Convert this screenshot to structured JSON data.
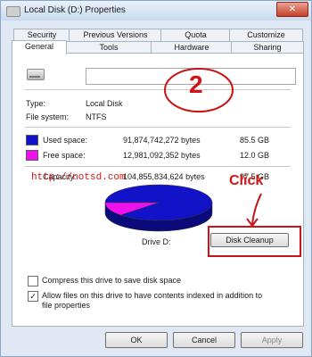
{
  "window": {
    "title": "Local Disk (D:) Properties",
    "close_glyph": "✕"
  },
  "tabs_back": [
    "Security",
    "Previous Versions",
    "Quota",
    "Customize"
  ],
  "tabs_front": [
    "General",
    "Tools",
    "Hardware",
    "Sharing"
  ],
  "general": {
    "name_value": "",
    "type_label": "Type:",
    "type_value": "Local Disk",
    "fs_label": "File system:",
    "fs_value": "NTFS",
    "used": {
      "label": "Used space:",
      "bytes": "91,874,742,272 bytes",
      "size": "85.5 GB",
      "color": "#1212c8"
    },
    "free": {
      "label": "Free space:",
      "bytes": "12,981,092,352 bytes",
      "size": "12.0 GB",
      "color": "#ee10ee"
    },
    "capacity": {
      "label": "Capacity:",
      "bytes": "104,855,834,624 bytes",
      "size": "97.5 GB"
    },
    "drive_label": "Drive D:",
    "cleanup_label": "Disk Cleanup",
    "compress_label": "Compress this drive to save disk space",
    "compress_checked": false,
    "index_label_line1": "Allow files on this drive to have contents indexed in addition to",
    "index_label_line2": "file properties",
    "index_checked": true,
    "check_glyph": "✓"
  },
  "buttons": {
    "ok": "OK",
    "cancel": "Cancel",
    "apply": "Apply"
  },
  "annotations": {
    "number": "2",
    "click": "Click",
    "watermark": "http://notsd.com"
  }
}
